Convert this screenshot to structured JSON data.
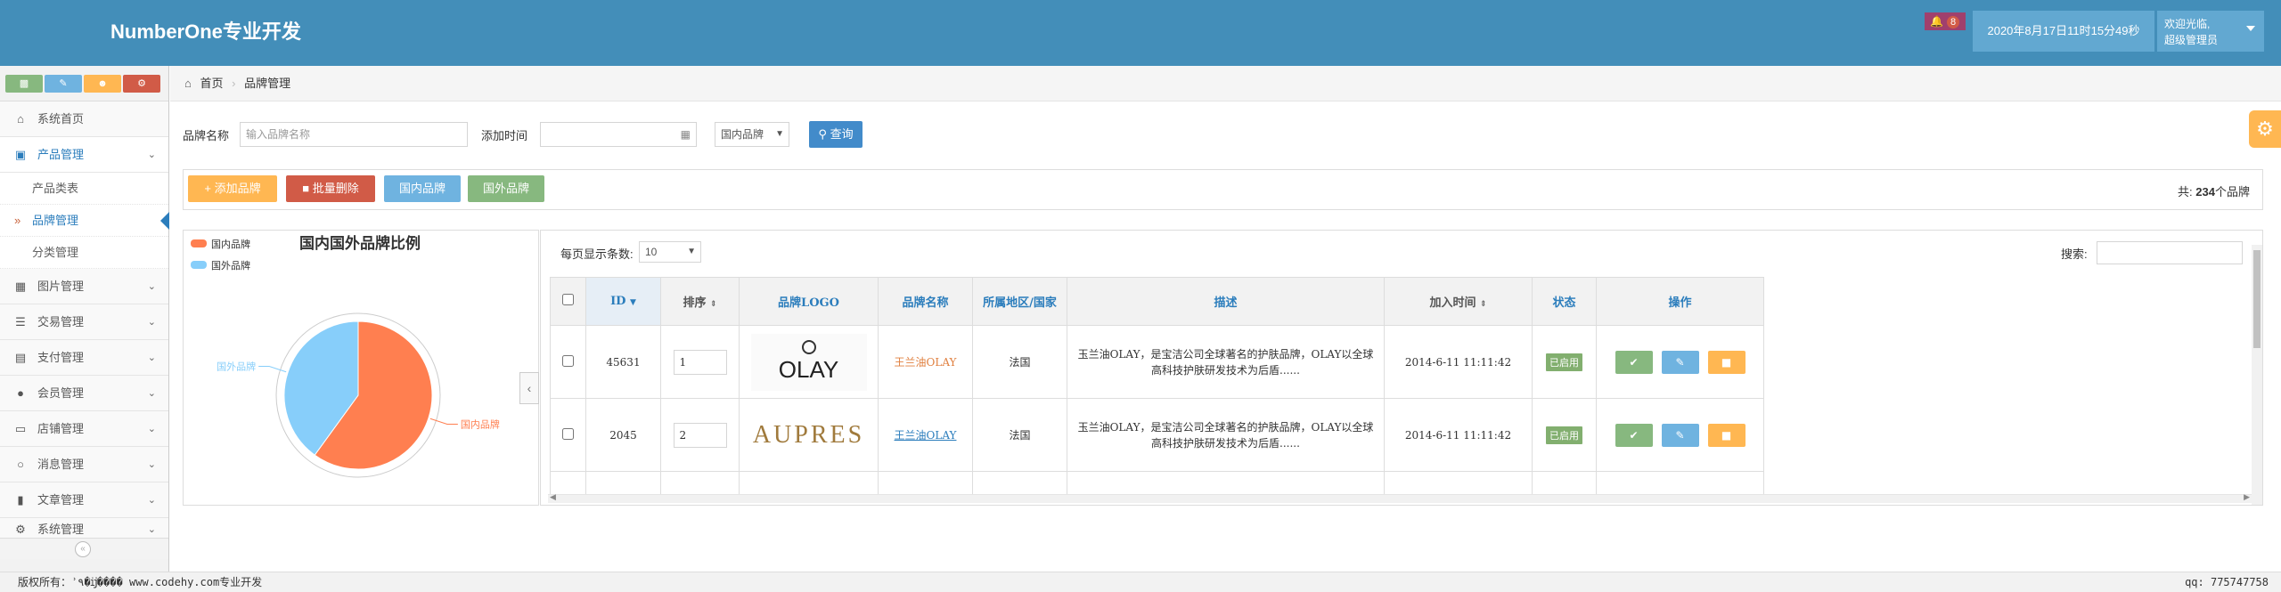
{
  "header": {
    "brand": "NumberOne专业开发",
    "notification_count": "8",
    "datetime": "2020年8月17日11时15分49秒",
    "welcome": "欢迎光临,",
    "role": "超级管理员"
  },
  "sidebar": {
    "items": [
      {
        "label": "系统首页",
        "icon": "home-icon"
      },
      {
        "label": "产品管理",
        "icon": "desktop-icon"
      },
      {
        "label": "图片管理",
        "icon": "picture-icon"
      },
      {
        "label": "交易管理",
        "icon": "list-icon"
      },
      {
        "label": "支付管理",
        "icon": "credit-card-icon"
      },
      {
        "label": "会员管理",
        "icon": "user-icon"
      },
      {
        "label": "店铺管理",
        "icon": "laptop-icon"
      },
      {
        "label": "消息管理",
        "icon": "comments-icon"
      },
      {
        "label": "文章管理",
        "icon": "bookmark-icon"
      },
      {
        "label": "系统管理",
        "icon": "cogs-icon"
      }
    ],
    "sub_items": [
      "产品类表",
      "品牌管理",
      "分类管理"
    ]
  },
  "breadcrumb": {
    "home": "首页",
    "current": "品牌管理"
  },
  "search": {
    "brand_label": "品牌名称",
    "brand_placeholder": "输入品牌名称",
    "time_label": "添加时间",
    "select_value": "国内品牌",
    "query_button": "查询"
  },
  "toolbar": {
    "add_label": "添加品牌",
    "batch_delete_label": "批量删除",
    "domestic_label": "国内品牌",
    "foreign_label": "国外品牌",
    "total_prefix": "共:",
    "total_count": "234",
    "total_suffix": "个品牌"
  },
  "chart_data": {
    "type": "pie",
    "title": "国内国外品牌比例",
    "legend_position": "top-left",
    "categories": [
      "国内品牌",
      "国外品牌"
    ],
    "values": [
      60,
      40
    ],
    "colors": [
      "#ff7f50",
      "#87cefa"
    ]
  },
  "table": {
    "page_size_label": "每页显示条数:",
    "page_size_value": "10",
    "search_label": "搜索:",
    "columns": [
      "ID",
      "排序",
      "品牌LOGO",
      "品牌名称",
      "所属地区/国家",
      "描述",
      "加入时间",
      "状态",
      "操作"
    ],
    "rows": [
      {
        "id": "45631",
        "sort": "1",
        "logo": "OLAY",
        "name": "王兰油OLAY",
        "region": "法国",
        "desc": "玉兰油OLAY，是宝洁公司全球著名的护肤品牌，OLAY以全球高科技护肤研发技术为后盾......",
        "time": "2014-6-11 11:11:42",
        "status": "已启用"
      },
      {
        "id": "2045",
        "sort": "2",
        "logo": "AUPRES",
        "name": "王兰油OLAY",
        "region": "法国",
        "desc": "玉兰油OLAY，是宝洁公司全球著名的护肤品牌，OLAY以全球高科技护肤研发技术为后盾......",
        "time": "2014-6-11 11:11:42",
        "status": "已启用"
      }
    ]
  },
  "footer": {
    "copyright": "版权所有：ʾ٩�ĳ���� www.codehy.com专业开发",
    "qq": "qq: 775747758"
  }
}
